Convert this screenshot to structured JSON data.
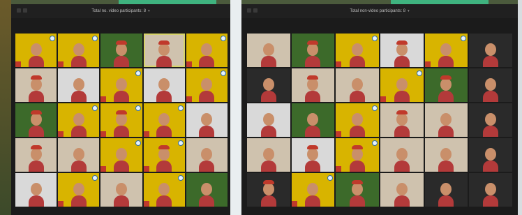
{
  "left_window": {
    "title": "Total no. video participants: 8",
    "tiles": [
      {
        "style": "yellow",
        "hat": false
      },
      {
        "style": "yellow",
        "hat": false
      },
      {
        "style": "green",
        "hat": true
      },
      {
        "style": "room",
        "hat": true,
        "active": true
      },
      {
        "style": "yellow",
        "hat": false
      },
      {
        "style": "room",
        "hat": true
      },
      {
        "style": "white",
        "hat": false
      },
      {
        "style": "yellow",
        "hat": false
      },
      {
        "style": "white",
        "hat": false
      },
      {
        "style": "yellow",
        "hat": false
      },
      {
        "style": "green",
        "hat": true
      },
      {
        "style": "yellow",
        "hat": false
      },
      {
        "style": "yellow",
        "hat": true
      },
      {
        "style": "yellow",
        "hat": false
      },
      {
        "style": "white",
        "hat": false
      },
      {
        "style": "room",
        "hat": true
      },
      {
        "style": "room",
        "hat": false
      },
      {
        "style": "yellow",
        "hat": false
      },
      {
        "style": "yellow",
        "hat": true
      },
      {
        "style": "room",
        "hat": false
      },
      {
        "style": "white",
        "hat": false
      },
      {
        "style": "yellow",
        "hat": false
      },
      {
        "style": "room",
        "hat": false
      },
      {
        "style": "yellow",
        "hat": false
      },
      {
        "style": "green",
        "hat": false
      }
    ]
  },
  "right_window": {
    "title": "Total non-video participants: 8",
    "tiles": [
      {
        "style": "room",
        "hat": false
      },
      {
        "style": "green",
        "hat": true
      },
      {
        "style": "yellow",
        "hat": false
      },
      {
        "style": "white",
        "hat": true
      },
      {
        "style": "yellow",
        "hat": false
      },
      {
        "style": "dark",
        "hat": false
      },
      {
        "style": "dark",
        "hat": false
      },
      {
        "style": "room",
        "hat": true
      },
      {
        "style": "room",
        "hat": false
      },
      {
        "style": "yellow",
        "hat": false
      },
      {
        "style": "green",
        "hat": true
      },
      {
        "style": "dark",
        "hat": false
      },
      {
        "style": "white",
        "hat": false
      },
      {
        "style": "green",
        "hat": false
      },
      {
        "style": "yellow",
        "hat": false
      },
      {
        "style": "room",
        "hat": true
      },
      {
        "style": "room",
        "hat": false
      },
      {
        "style": "dark",
        "hat": false
      },
      {
        "style": "room",
        "hat": false
      },
      {
        "style": "white",
        "hat": true
      },
      {
        "style": "yellow",
        "hat": true
      },
      {
        "style": "room",
        "hat": false
      },
      {
        "style": "room",
        "hat": false
      },
      {
        "style": "dark",
        "hat": false
      },
      {
        "style": "dark",
        "hat": true
      },
      {
        "style": "yellow",
        "hat": false
      },
      {
        "style": "green",
        "hat": true
      },
      {
        "style": "room",
        "hat": false
      },
      {
        "style": "dark",
        "hat": false
      },
      {
        "style": "dark",
        "hat": false
      }
    ]
  }
}
